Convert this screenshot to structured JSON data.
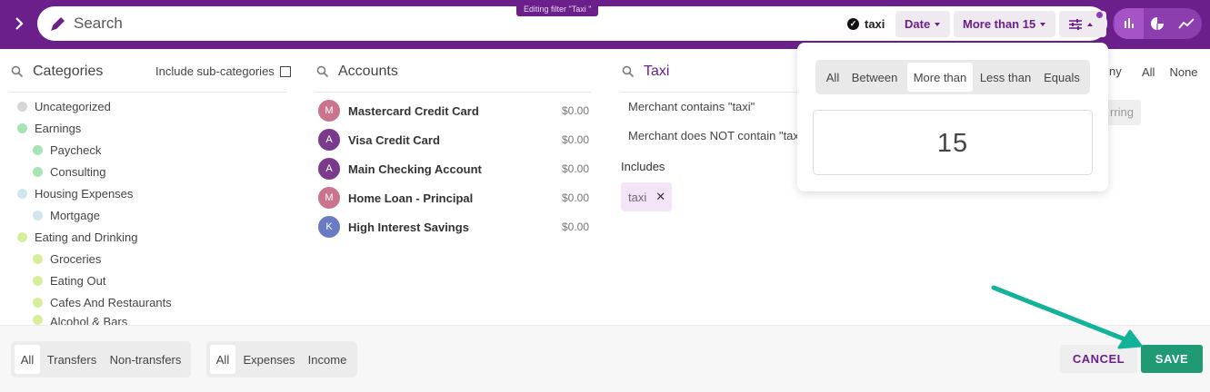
{
  "header": {
    "search_placeholder": "Search",
    "editing_tooltip": "Editing filter \"Taxi \"",
    "chip_taxi": "taxi",
    "date_label": "Date",
    "more_than_label": "More than 15",
    "accent": "#6b1f8a"
  },
  "categories": {
    "title": "Categories",
    "include_sub": "Include sub-categories",
    "items": [
      {
        "label": "Uncategorized",
        "color": "#d6d6d6"
      },
      {
        "label": "Earnings",
        "color": "#a6e4b3"
      },
      {
        "label": "Paycheck",
        "color": "#a6e4b3"
      },
      {
        "label": "Consulting",
        "color": "#a6e4b3"
      },
      {
        "label": "Housing Expenses",
        "color": "#cfe6ee"
      },
      {
        "label": "Mortgage",
        "color": "#cfe6ee"
      },
      {
        "label": "Eating and Drinking",
        "color": "#d7ef9a"
      },
      {
        "label": "Groceries",
        "color": "#d7ef9a"
      },
      {
        "label": "Eating Out",
        "color": "#d7ef9a"
      },
      {
        "label": "Cafes And Restaurants",
        "color": "#d7ef9a"
      },
      {
        "label": "Alcohol & Bars",
        "color": "#d7ef9a"
      }
    ]
  },
  "accounts": {
    "title": "Accounts",
    "items": [
      {
        "initial": "M",
        "name": "Mastercard Credit Card",
        "amount": "$0.00",
        "color": "#c9738d"
      },
      {
        "initial": "A",
        "name": "Visa Credit Card",
        "amount": "$0.00",
        "color": "#7a3a8c"
      },
      {
        "initial": "A",
        "name": "Main Checking Account",
        "amount": "$0.00",
        "color": "#7a3a8c"
      },
      {
        "initial": "M",
        "name": "Home Loan - Principal",
        "amount": "$0.00",
        "color": "#c9738d"
      },
      {
        "initial": "K",
        "name": "High Interest Savings",
        "amount": "$0.00",
        "color": "#6b7ac4"
      }
    ]
  },
  "merchant": {
    "title": "Taxi",
    "rule_contains": "Merchant contains \"taxi\"",
    "rule_not_contains": "Merchant does NOT contain \"taxi\"",
    "includes_label": "Includes",
    "tag": "taxi",
    "tag_remove": "✕",
    "seg_any": "ny",
    "seg_all": "All",
    "seg_none": "None",
    "recurring_fragment": "rring"
  },
  "amount_popover": {
    "options": [
      "All",
      "Between",
      "More than",
      "Less than",
      "Equals"
    ],
    "selected": "More than",
    "value": "15"
  },
  "bottom": {
    "transfer_options": [
      "All",
      "Transfers",
      "Non-transfers"
    ],
    "type_options": [
      "All",
      "Expenses",
      "Income"
    ],
    "cancel": "CANCEL",
    "save": "SAVE",
    "annotation_color": "#13b39a"
  }
}
